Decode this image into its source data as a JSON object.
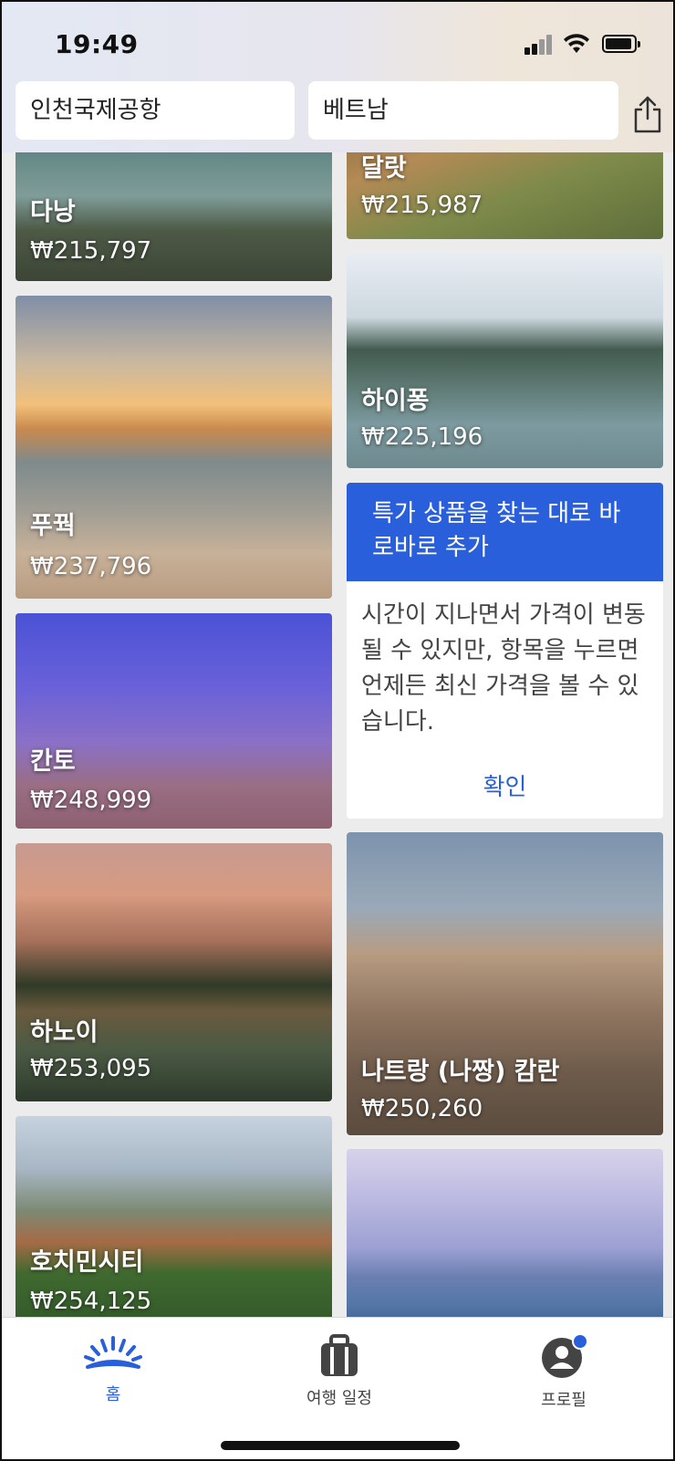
{
  "status": {
    "time": "19:49"
  },
  "search": {
    "origin": "인천국제공항",
    "destination": "베트남",
    "share_icon": "share-icon"
  },
  "destinations": [
    {
      "name": "다낭",
      "price": "₩215,797"
    },
    {
      "name": "달랏",
      "price": "₩215,987"
    },
    {
      "name": "푸꿕",
      "price": "₩237,796"
    },
    {
      "name": "하이퐁",
      "price": "₩225,196"
    },
    {
      "name": "칸토",
      "price": "₩248,999"
    },
    {
      "name": "하노이",
      "price": "₩253,095"
    },
    {
      "name": "호치민시티",
      "price": "₩254,125"
    },
    {
      "name": "나트랑 (나짱) 캄란",
      "price": "₩250,260"
    }
  ],
  "tip": {
    "title": "특가 상품을 찾는 대로 바로바로 추가",
    "body": "시간이 지나면서 가격이 변동될 수 있지만, 항목을 누르면 언제든 최신 가격을 볼 수 있습니다.",
    "confirm_label": "확인"
  },
  "tabs": [
    {
      "label": "홈",
      "icon": "home-sunrise-icon",
      "active": true
    },
    {
      "label": "여행 일정",
      "icon": "luggage-icon",
      "active": false
    },
    {
      "label": "프로필",
      "icon": "profile-icon",
      "active": false
    }
  ],
  "colors": {
    "accent": "#2a5fdc",
    "notification_dot": "#2a5fdc"
  }
}
